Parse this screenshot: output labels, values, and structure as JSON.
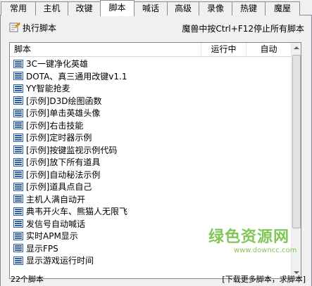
{
  "tabs": [
    {
      "label": "常用"
    },
    {
      "label": "主机"
    },
    {
      "label": "改键"
    },
    {
      "label": "脚本",
      "active": true
    },
    {
      "label": "喊话"
    },
    {
      "label": "高级"
    },
    {
      "label": "录像"
    },
    {
      "label": "热键"
    },
    {
      "label": "魔屋"
    }
  ],
  "toolbar": {
    "execute_label": "执行脚本",
    "hint": "魔兽中按Ctrl+F12停止所有脚本"
  },
  "list": {
    "columns": [
      "脚本",
      "运行中",
      "自动"
    ],
    "rows": [
      "3C一键净化英雄",
      "DOTA、真三通用改键v1.1",
      "YY智能抢麦",
      "[示例]D3D绘图函数",
      "[示例]单击英雄头像",
      "[示例]右击技能",
      "[示例]定时器示例",
      "[示例]按键监视示例代码",
      "[示例]放下所有道具",
      "[示例]自动秘法示例",
      "[示例]道具点自己",
      "主机人满自动开",
      "典韦开火车、熊猫人无限飞",
      "发信号自动喊话",
      "实时APM显示",
      "显示FPS",
      "显示游戏运行时间"
    ]
  },
  "status": {
    "count": "22个脚本",
    "more_link": "[下载更多脚本，求脚本]"
  },
  "watermark": {
    "text": "绿色资源网",
    "url": "www.downcc.com"
  },
  "colors": {
    "border": "#898c95",
    "icon_blue": "#2e5da8",
    "watermark_green": "#6cbd3c"
  }
}
